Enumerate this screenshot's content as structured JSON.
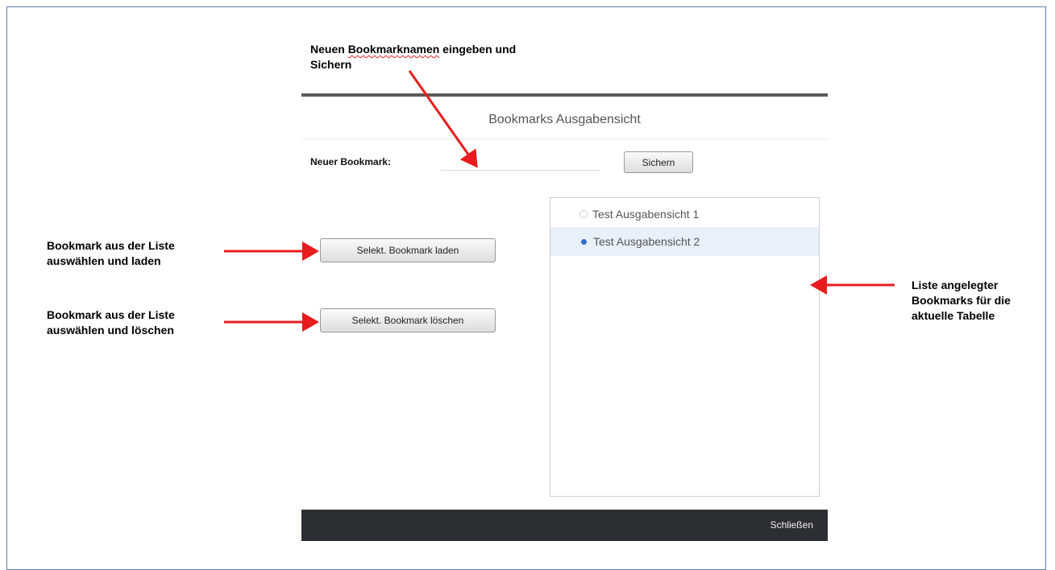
{
  "annotations": {
    "top_line1_a": "Neuen ",
    "top_line1_b": "Bookmarknamen",
    "top_line1_c": " eingeben und",
    "top_line2": "Sichern",
    "load_line1": "Bookmark aus der Liste",
    "load_line2": "auswählen und laden",
    "delete_line1": "Bookmark aus der Liste",
    "delete_line2": "auswählen und löschen",
    "list_line1": "Liste angelegter",
    "list_line2": "Bookmarks für die",
    "list_line3": "aktuelle Tabelle"
  },
  "dialog": {
    "title": "Bookmarks Ausgabensicht",
    "new_label": "Neuer Bookmark:",
    "new_value": "",
    "save_button": "Sichern",
    "load_button": "Selekt. Bookmark laden",
    "delete_button": "Selekt. Bookmark löschen",
    "bookmarks": [
      {
        "label": "Test Ausgabensicht 1",
        "selected": false
      },
      {
        "label": "Test Ausgabensicht 2",
        "selected": true
      }
    ],
    "close_button": "Schließen"
  },
  "colors": {
    "arrow": "#e81c1c",
    "footer": "#2b2e33",
    "selected_row": "#e8f0fa",
    "radio_selected": "#2b6fcf"
  }
}
